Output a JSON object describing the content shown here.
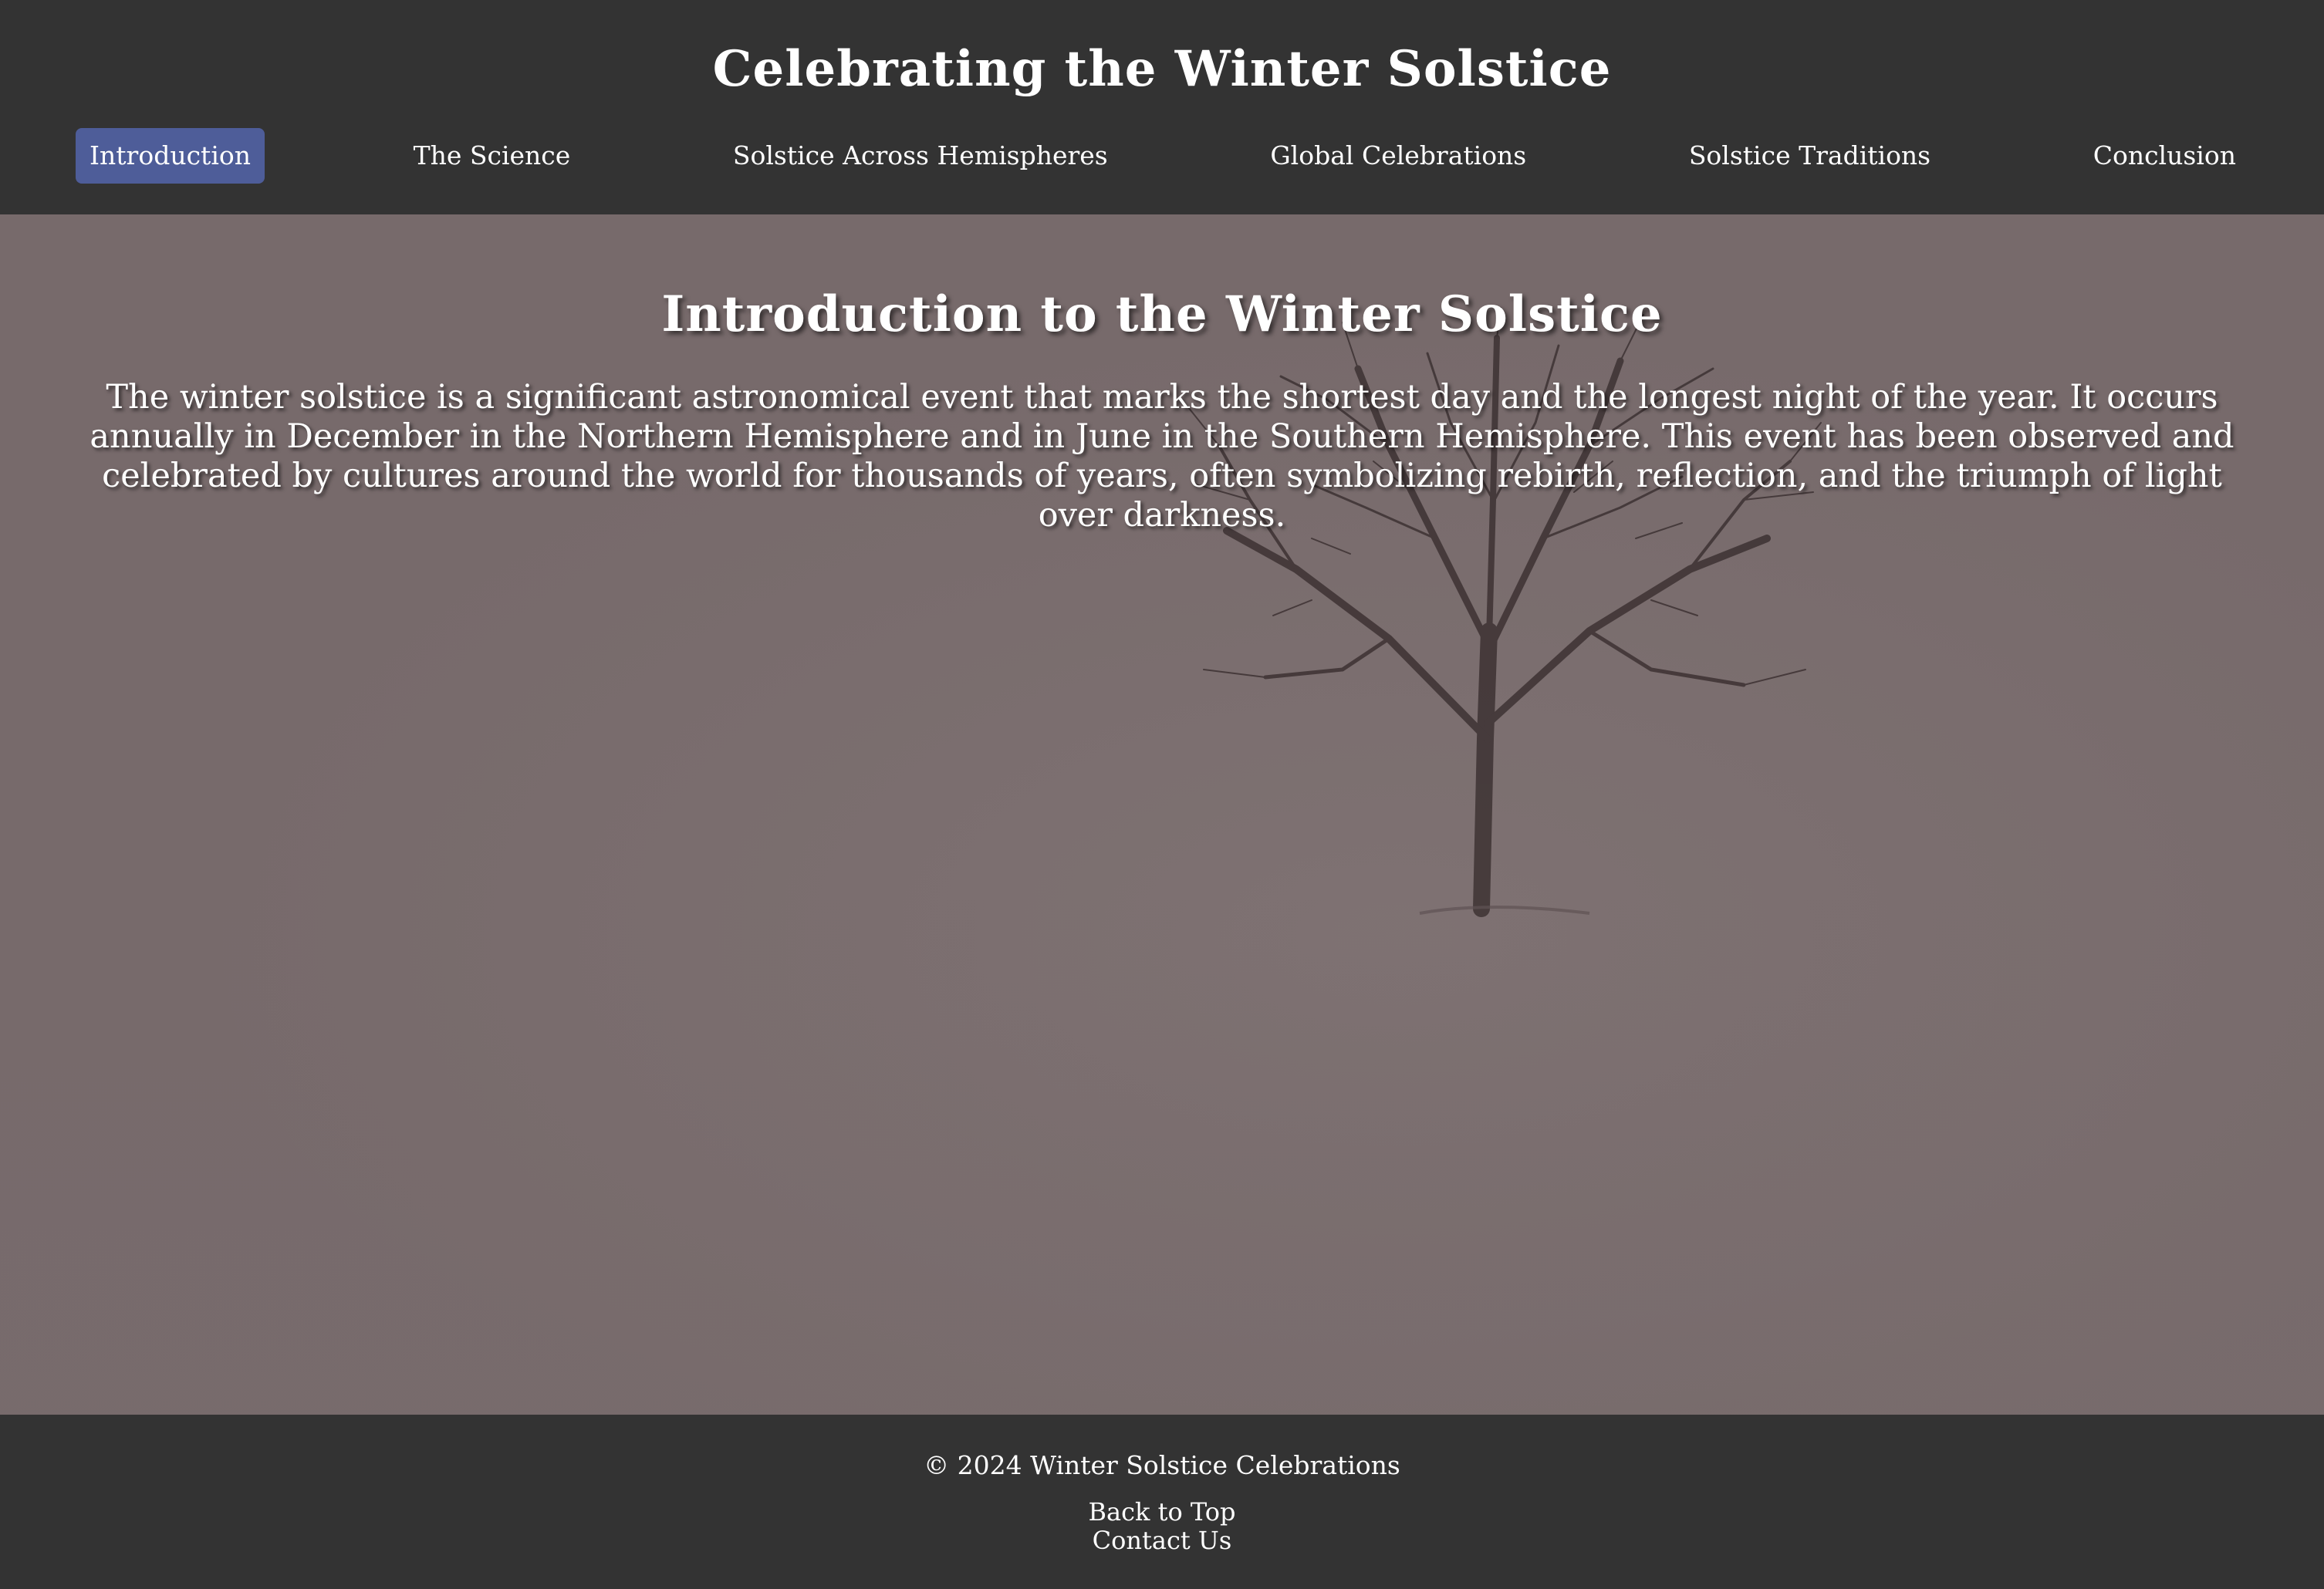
{
  "header": {
    "title": "Celebrating the Winter Solstice",
    "nav": [
      {
        "label": "Introduction"
      },
      {
        "label": "The Science"
      },
      {
        "label": "Solstice Across Hemispheres"
      },
      {
        "label": "Global Celebrations"
      },
      {
        "label": "Solstice Traditions"
      },
      {
        "label": "Conclusion"
      }
    ],
    "active_nav": "Introduction"
  },
  "main": {
    "section_title": "Introduction to the Winter Solstice",
    "section_text": "The winter solstice is a significant astronomical event that marks the shortest day and the longest night of the year. It occurs annually in December in the Northern Hemisphere and in June in the Southern Hemisphere. This event has been observed and celebrated by cultures around the world for thousands of years, often symbolizing rebirth, reflection, and the triumph of light over darkness."
  },
  "footer": {
    "copyright": "© 2024 Winter Solstice Celebrations",
    "links": [
      {
        "label": "Back to Top"
      },
      {
        "label": "Contact Us"
      }
    ]
  },
  "colors": {
    "header_bg": "#333333",
    "nav_active_bg": "#4e5d99",
    "main_bg": "#776a6b",
    "text": "#ffffff"
  }
}
